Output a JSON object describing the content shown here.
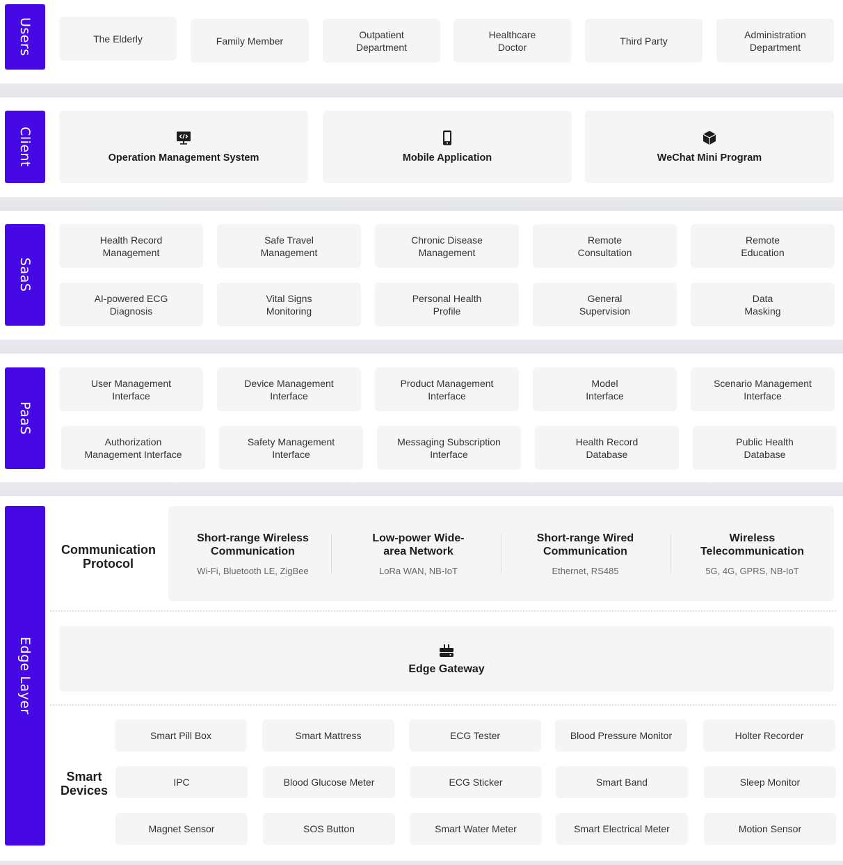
{
  "layers": {
    "users": {
      "label": "Users",
      "items": [
        "The Elderly",
        "Family Member",
        "Outpatient Department",
        "Healthcare Doctor",
        "Third Party",
        "Administration Department"
      ]
    },
    "client": {
      "label": "Client",
      "items": [
        {
          "label": "Operation Management System",
          "icon": "monitor-code-icon"
        },
        {
          "label": "Mobile Application",
          "icon": "smartphone-icon"
        },
        {
          "label": "WeChat Mini Program",
          "icon": "cube-icon"
        }
      ]
    },
    "saas": {
      "label": "SaaS",
      "items": [
        "Health Record Management",
        "Safe Travel Management",
        "Chronic Disease Management",
        "Remote Consultation",
        "Remote Education",
        "AI-powered ECG Diagnosis",
        "Vital Signs Monitoring",
        "Personal Health Profile",
        "General Supervision",
        "Data Masking"
      ]
    },
    "paas": {
      "label": "PaaS",
      "items": [
        "User Management Interface",
        "Device Management Interface",
        "Product Management Interface",
        "Model Interface",
        "Scenario Management Interface",
        "Authorization Management Interface",
        "Safety Management Interface",
        "Messaging Subscription Interface",
        "Health Record Database",
        "Public Health Database"
      ]
    },
    "edge": {
      "label": "Edge Layer",
      "communication": {
        "label": "Communication Protocol",
        "protocols": [
          {
            "title": "Short-range Wireless Communication",
            "examples": "Wi-Fi, Bluetooth LE, ZigBee"
          },
          {
            "title": "Low-power Wide-area Network",
            "examples": "LoRa WAN, NB-IoT"
          },
          {
            "title": "Short-range Wired Communication",
            "examples": "Ethernet, RS485"
          },
          {
            "title": "Wireless Telecommunication",
            "examples": "5G, 4G, GPRS, NB-IoT"
          }
        ]
      },
      "gateway": {
        "label": "Edge Gateway",
        "icon": "router-icon"
      },
      "devices": {
        "label": "Smart Devices",
        "items": [
          "Smart Pill Box",
          "Smart Mattress",
          "ECG Tester",
          "Blood Pressure Monitor",
          "Holter Recorder",
          "IPC",
          "Blood Glucose Meter",
          "ECG Sticker",
          "Smart Band",
          "Sleep Monitor",
          "Magnet Sensor",
          "SOS Button",
          "Smart Water Meter",
          "Smart Electrical Meter",
          "Motion Sensor"
        ]
      }
    }
  },
  "colors": {
    "accent": "#4609e6",
    "card": "#f5f5f5",
    "separator": "#e6e7eb"
  }
}
